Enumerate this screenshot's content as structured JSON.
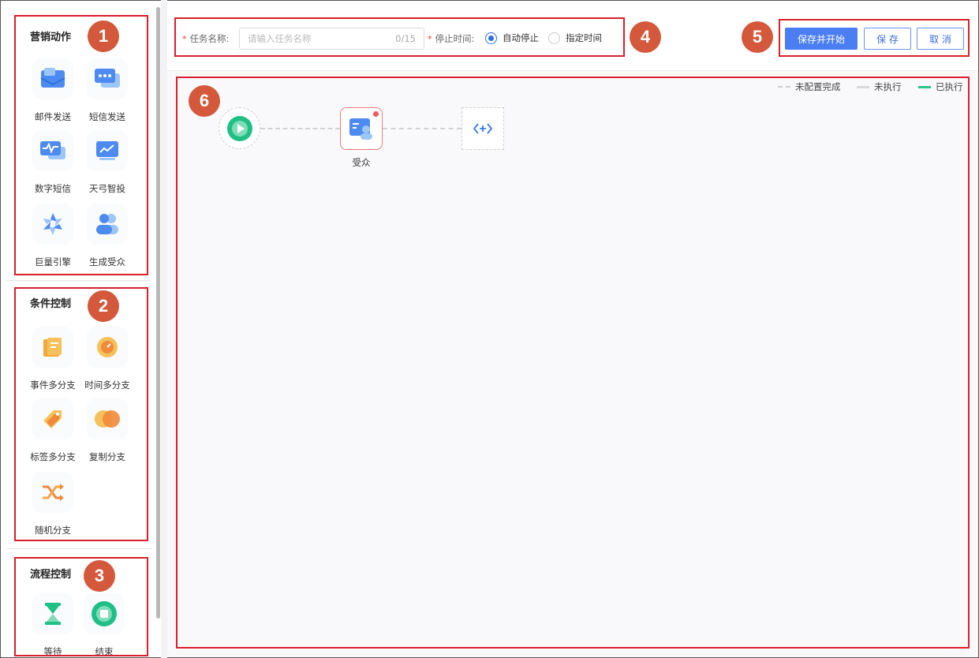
{
  "sidebar": {
    "sections": [
      {
        "title": "营销动作",
        "badge": "1",
        "items": [
          {
            "label": "邮件发送",
            "icon": "mail-icon"
          },
          {
            "label": "短信发送",
            "icon": "sms-icon"
          },
          {
            "label": "数字短信",
            "icon": "digital-sms-icon"
          },
          {
            "label": "天弓智投",
            "icon": "smart-ads-icon"
          },
          {
            "label": "巨量引擎",
            "icon": "ocean-engine-icon"
          },
          {
            "label": "生成受众",
            "icon": "generate-audience-icon"
          }
        ]
      },
      {
        "title": "条件控制",
        "badge": "2",
        "items": [
          {
            "label": "事件多分支",
            "icon": "event-branch-icon"
          },
          {
            "label": "时间多分支",
            "icon": "time-branch-icon"
          },
          {
            "label": "标签多分支",
            "icon": "tag-branch-icon"
          },
          {
            "label": "复制分支",
            "icon": "copy-branch-icon"
          },
          {
            "label": "随机分支",
            "icon": "random-branch-icon"
          }
        ]
      },
      {
        "title": "流程控制",
        "badge": "3",
        "items": [
          {
            "label": "等待",
            "icon": "hourglass-icon"
          },
          {
            "label": "结束",
            "icon": "stop-icon"
          }
        ]
      }
    ]
  },
  "toolbar": {
    "badge": "4",
    "task_name_label": "任务名称:",
    "task_name_placeholder": "请输入任务名称",
    "task_name_counter": "0/15",
    "stop_time_label": "停止时间:",
    "stop_options": [
      {
        "label": "自动停止",
        "selected": true
      },
      {
        "label": "指定时间",
        "selected": false
      }
    ]
  },
  "actions": {
    "badge": "5",
    "save_and_start": "保存并开始",
    "save": "保 存",
    "cancel": "取 消"
  },
  "canvas": {
    "badge": "6",
    "legend": [
      {
        "label": "未配置完成",
        "color": "#cccccc",
        "style": "dashed"
      },
      {
        "label": "未执行",
        "color": "#d9d9d9",
        "style": "solid"
      },
      {
        "label": "已执行",
        "color": "#2fc48d",
        "style": "solid"
      }
    ],
    "nodes": {
      "audience_label": "受众"
    }
  },
  "colors": {
    "accent": "#4a7ef2",
    "annotation_red": "#d9202b",
    "badge_orange": "#d4583c"
  }
}
